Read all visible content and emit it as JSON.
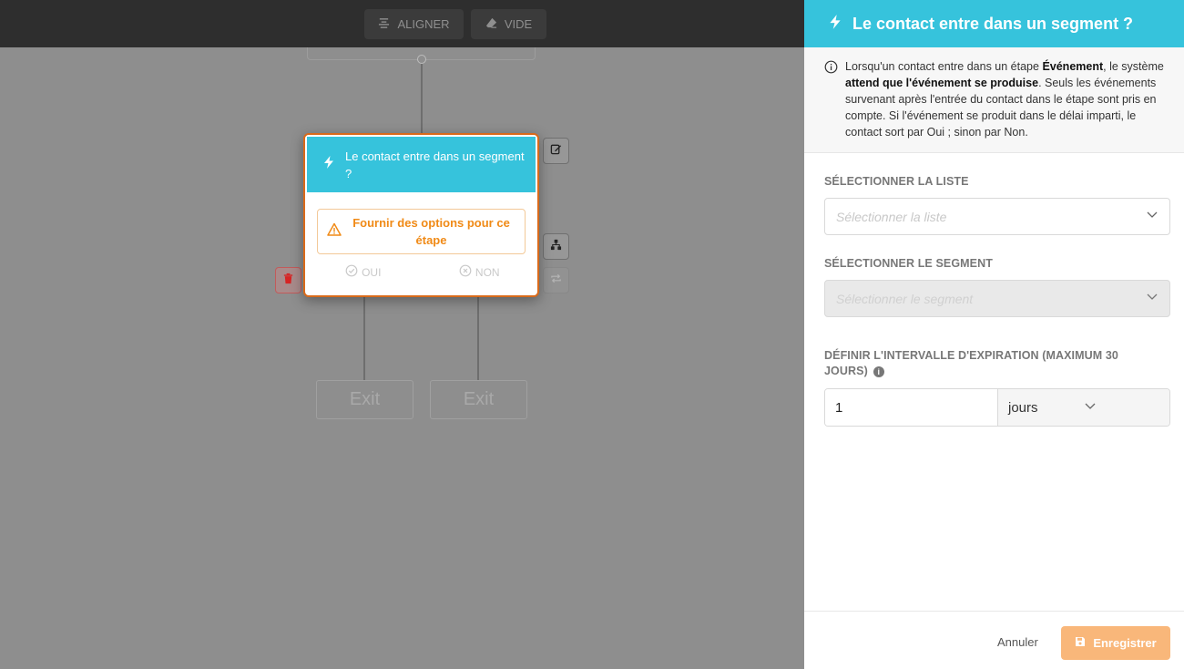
{
  "toolbar": {
    "align_label": "ALIGNER",
    "clear_label": "VIDE"
  },
  "canvas": {
    "node": {
      "title": "Le contact entre dans un segment ?",
      "warning": "Fournir des options pour ce étape",
      "yes_label": "OUI",
      "no_label": "NON"
    },
    "exits": [
      "Exit",
      "Exit"
    ]
  },
  "panel": {
    "title": "Le contact entre dans un segment ?",
    "info": {
      "p1": "Lorsqu'un contact entre dans un étape ",
      "b1": "Événement",
      "p2": ", le système ",
      "b2": "attend que l'événement se produise",
      "p3": ". Seuls les événements survenant après l'entrée du contact dans le étape sont pris en compte. Si l'événement se produit dans le délai imparti, le contact sort par Oui ; sinon par Non."
    },
    "list_label": "SÉLECTIONNER LA LISTE",
    "list_placeholder": "Sélectionner la liste",
    "segment_label": "SÉLECTIONNER LE SEGMENT",
    "segment_placeholder": "Sélectionner le segment",
    "interval_label": "DÉFINIR L'INTERVALLE D'EXPIRATION (MAXIMUM 30 JOURS)",
    "interval_value": "1",
    "interval_unit": "jours",
    "cancel_label": "Annuler",
    "save_label": "Enregistrer"
  },
  "colors": {
    "accent": "#36c3dc",
    "warning": "#f08a16",
    "node_border": "#d96a1a",
    "save_button": "#f9b77a"
  }
}
